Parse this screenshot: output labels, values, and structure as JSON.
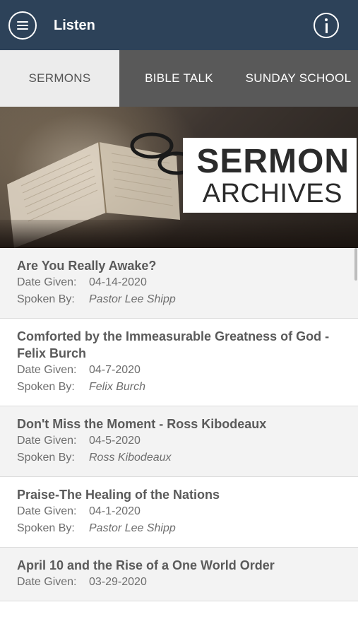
{
  "header": {
    "title": "Listen",
    "menu_icon": "hamburger-menu-icon",
    "info_icon": "info-icon",
    "bg_color": "#2d4259"
  },
  "tabs": [
    {
      "label": "SERMONS",
      "active": true
    },
    {
      "label": "BIBLE TALK",
      "active": false
    },
    {
      "label": "SUNDAY SCHOOL",
      "active": false
    }
  ],
  "banner": {
    "title": "SERMON",
    "subtitle": "ARCHIVES"
  },
  "labels": {
    "date_given": "Date Given:",
    "spoken_by": "Spoken By:"
  },
  "sermons": [
    {
      "title": "Are You Really Awake?",
      "date": "04-14-2020",
      "speaker": "Pastor Lee Shipp"
    },
    {
      "title": "Comforted by the Immeasurable Greatness of God - Felix Burch",
      "date": "04-7-2020",
      "speaker": "Felix Burch"
    },
    {
      "title": "Don't Miss the Moment - Ross Kibodeaux",
      "date": "04-5-2020",
      "speaker": "Ross Kibodeaux"
    },
    {
      "title": "Praise-The Healing of the Nations",
      "date": "04-1-2020",
      "speaker": "Pastor Lee Shipp"
    },
    {
      "title": "April 10 and the Rise of a One World Order",
      "date": "03-29-2020",
      "speaker": ""
    }
  ]
}
